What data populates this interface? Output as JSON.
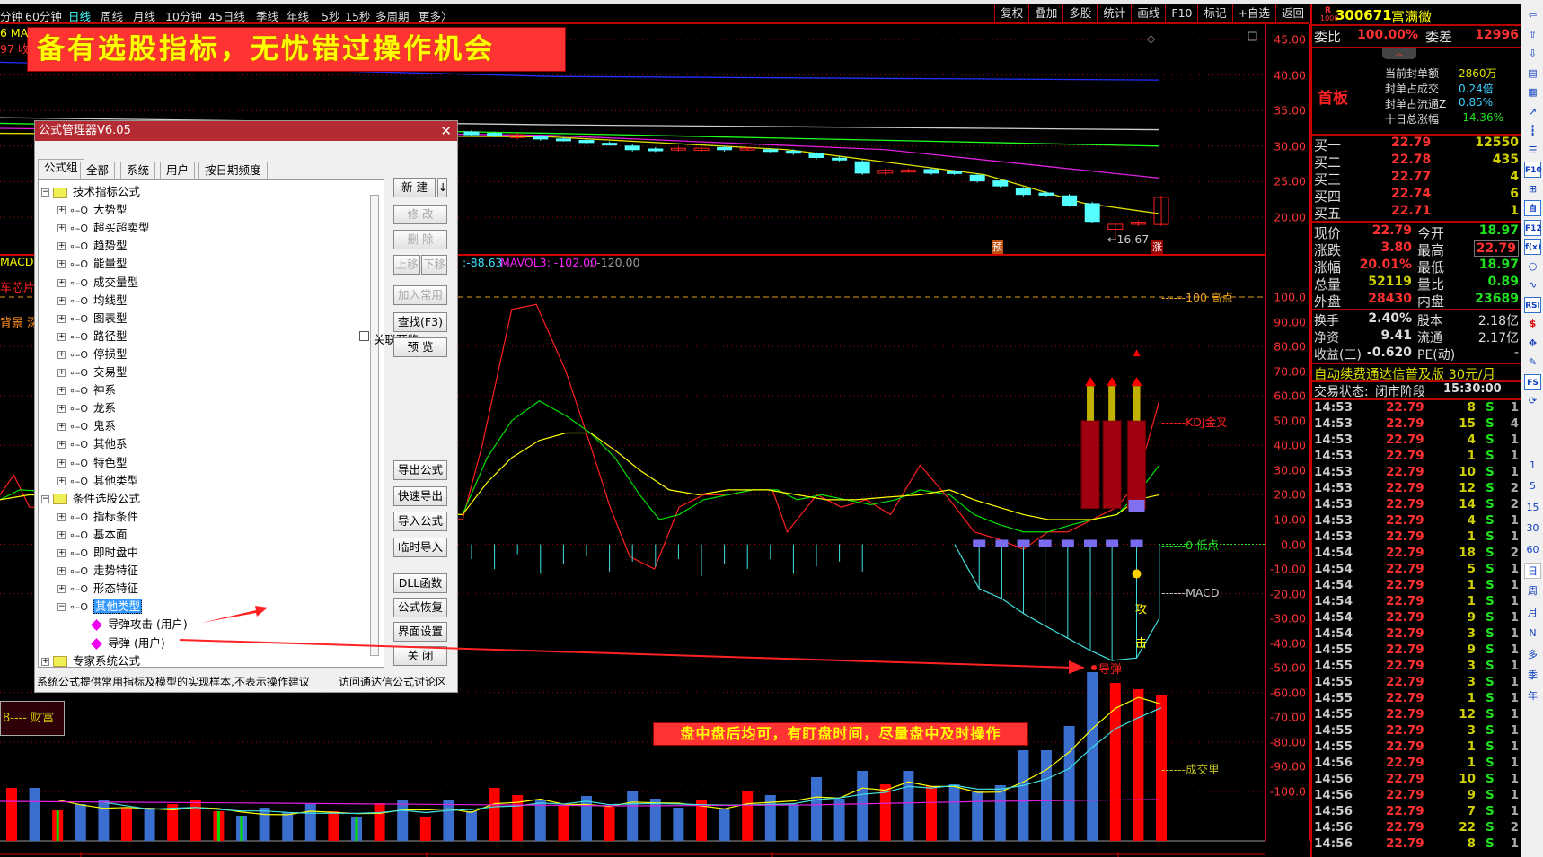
{
  "toolbar": {
    "periods": [
      {
        "label": "分钟",
        "selected": false
      },
      {
        "label": "60分钟",
        "selected": false
      },
      {
        "label": "日线",
        "selected": true
      },
      {
        "label": "周线",
        "selected": false
      },
      {
        "label": "月线",
        "selected": false
      },
      {
        "label": "10分钟",
        "selected": false
      },
      {
        "label": "45日线",
        "selected": false
      },
      {
        "label": "季线",
        "selected": false
      },
      {
        "label": "年线",
        "selected": false
      },
      {
        "label": "5秒",
        "selected": false
      },
      {
        "label": "15秒",
        "selected": false
      },
      {
        "label": "多周期",
        "selected": false
      },
      {
        "label": "更多〉",
        "selected": false
      }
    ],
    "buttons": [
      "复权",
      "叠加",
      "多股",
      "统计",
      "画线",
      "F10",
      "标记",
      "+自选",
      "返回"
    ]
  },
  "banner_top": "备有选股指标，无忧错过操作机会",
  "banner_bottom": "盘中盘后均可，有盯盘时间，尽量盘中及时操作",
  "chart": {
    "left_labels": {
      "ma_fragment": "6  MA",
      "close_fragment": "97 收",
      "macd_fragment": "MACD:",
      "concept1": "车芯片",
      "concept2": "背景 深股",
      "caifu": "8---- 财富"
    },
    "indicator_values": {
      "v1": ":-88.63",
      "mavol3": "MAVOL3: -102.00",
      "v3": ": -120.00"
    },
    "price_axis": [
      "45.00",
      "40.00",
      "35.00",
      "30.00",
      "25.00",
      "20.00"
    ],
    "ind_axis": [
      "100.0",
      "90.00",
      "80.00",
      "70.00",
      "60.00",
      "50.00",
      "40.00",
      "30.00",
      "20.00",
      "10.00",
      "0.00",
      "-10.00",
      "-20.00",
      "-30.00",
      "-40.00",
      "-50.00",
      "-60.00",
      "-70.00",
      "-80.00",
      "-90.00",
      "-100.0"
    ],
    "low_price_label": "←16.67",
    "badge_yu": "预",
    "badge_zhang": "涨",
    "line_labels": {
      "high": "------100 高点",
      "kdj": "------KDJ金叉",
      "low": "------0  低点",
      "macd": "------MACD",
      "volume": "------成交里"
    },
    "signal_attack1": "攻",
    "signal_attack2": "击",
    "missile": "导弹",
    "colors": {
      "up": "#ff2020",
      "down": "#54ffff",
      "k": "#ff2020",
      "d": "#00e000",
      "j": "#ffff00",
      "vol_blue": "#3a6fd0"
    }
  },
  "dialog": {
    "title": "公式管理器V6.05",
    "tabs": [
      "公式组",
      "全部",
      "系统",
      "用户",
      "按日期频度"
    ],
    "tree": [
      {
        "label": "技术指标公式",
        "level": 0,
        "type": "folder",
        "expanded": true
      },
      {
        "label": "大势型",
        "level": 1
      },
      {
        "label": "超买超卖型",
        "level": 1
      },
      {
        "label": "趋势型",
        "level": 1
      },
      {
        "label": "能量型",
        "level": 1
      },
      {
        "label": "成交量型",
        "level": 1
      },
      {
        "label": "均线型",
        "level": 1
      },
      {
        "label": "图表型",
        "level": 1
      },
      {
        "label": "路径型",
        "level": 1
      },
      {
        "label": "停损型",
        "level": 1
      },
      {
        "label": "交易型",
        "level": 1
      },
      {
        "label": "神系",
        "level": 1
      },
      {
        "label": "龙系",
        "level": 1
      },
      {
        "label": "鬼系",
        "level": 1
      },
      {
        "label": "其他系",
        "level": 1
      },
      {
        "label": "特色型",
        "level": 1
      },
      {
        "label": "其他类型",
        "level": 1
      },
      {
        "label": "条件选股公式",
        "level": 0,
        "type": "folder",
        "expanded": true
      },
      {
        "label": "指标条件",
        "level": 1
      },
      {
        "label": "基本面",
        "level": 1
      },
      {
        "label": "即时盘中",
        "level": 1
      },
      {
        "label": "走势特征",
        "level": 1
      },
      {
        "label": "形态特征",
        "level": 1
      },
      {
        "label": "其他类型",
        "level": 1,
        "expanded": true,
        "selected": true
      },
      {
        "label": "导弹攻击  (用户)",
        "level": 2,
        "type": "formula"
      },
      {
        "label": "导弹  (用户)",
        "level": 2,
        "type": "formula"
      },
      {
        "label": "专家系统公式",
        "level": 0,
        "type": "folder",
        "expanded": false
      }
    ],
    "buttons": {
      "new": "新  建",
      "new_arrow": "↓",
      "modify": "修  改",
      "delete": "删  除",
      "up": "上移",
      "down": "下移",
      "add_common": "加入常用",
      "find": "查找(F3)",
      "preview": "预  览",
      "link_preview": "关联预览",
      "export": "导出公式",
      "quick_export": "快速导出",
      "import": "导入公式",
      "temp_import": "临时导入",
      "dll": "DLL函数",
      "restore": "公式恢复",
      "ui_settings": "界面设置",
      "close": "关  闭"
    },
    "status_left": "系统公式提供常用指标及模型的实现样本,不表示操作建议",
    "status_right": "访问通达信公式讨论区"
  },
  "quote": {
    "badge_top": "R",
    "badge_bottom": "1000",
    "code": "300671",
    "name": "富满微",
    "weibi_label": "委比",
    "weibi": "100.00%",
    "weicha_label": "委差",
    "weicha": "12996",
    "board": "首板",
    "seal": [
      {
        "label": "当前封单额",
        "value": "2860万",
        "color": "#e0e000"
      },
      {
        "label": "封单占成交",
        "value": "0.24倍",
        "color": "#40d0ff"
      },
      {
        "label": "封单占流通Z",
        "value": "0.85%",
        "color": "#40d0ff"
      },
      {
        "label": "十日总涨幅",
        "value": "-14.36%",
        "color": "#20e020"
      }
    ],
    "bids": [
      {
        "label": "买一",
        "price": "22.79",
        "vol": "12550"
      },
      {
        "label": "买二",
        "price": "22.78",
        "vol": "435"
      },
      {
        "label": "买三",
        "price": "22.77",
        "vol": "4"
      },
      {
        "label": "买四",
        "price": "22.74",
        "vol": "6"
      },
      {
        "label": "买五",
        "price": "22.71",
        "vol": "1"
      }
    ],
    "stats": [
      {
        "l1": "现价",
        "v1": "22.79",
        "c1": "#ff3030",
        "l2": "今开",
        "v2": "18.97",
        "c2": "#20e020"
      },
      {
        "l1": "涨跌",
        "v1": "3.80",
        "c1": "#ff3030",
        "l2": "最高",
        "v2": "22.79",
        "c2": "#ff3030"
      },
      {
        "l1": "涨幅",
        "v1": "20.01%",
        "c1": "#ff3030",
        "l2": "最低",
        "v2": "18.97",
        "c2": "#20e020"
      },
      {
        "l1": "总量",
        "v1": "52119",
        "c1": "#d0d000",
        "l2": "量比",
        "v2": "0.89",
        "c2": "#20e020"
      },
      {
        "l1": "外盘",
        "v1": "28430",
        "c1": "#ff3030",
        "l2": "内盘",
        "v2": "23689",
        "c2": "#20e020"
      }
    ],
    "fund": [
      {
        "l1": "换手",
        "v1": "2.40%",
        "l2": "股本",
        "v2": "2.18亿"
      },
      {
        "l1": "净资",
        "v1": "9.41",
        "l2": "流通",
        "v2": "2.17亿"
      },
      {
        "l1": "收益(三)",
        "v1": "-0.620",
        "l2": "PE(动)",
        "v2": "-"
      }
    ],
    "promo": "自动续费通达信普及版  30元/月",
    "status_label": "交易状态:",
    "status_value": "闭市阶段",
    "status_time": "15:30:00",
    "trades": [
      [
        "14:53",
        "22.79",
        "8",
        "S",
        "1"
      ],
      [
        "14:53",
        "22.79",
        "15",
        "S",
        "4"
      ],
      [
        "14:53",
        "22.79",
        "4",
        "S",
        "1"
      ],
      [
        "14:53",
        "22.79",
        "1",
        "S",
        "1"
      ],
      [
        "14:53",
        "22.79",
        "10",
        "S",
        "1"
      ],
      [
        "14:53",
        "22.79",
        "12",
        "S",
        "2"
      ],
      [
        "14:53",
        "22.79",
        "14",
        "S",
        "2"
      ],
      [
        "14:53",
        "22.79",
        "4",
        "S",
        "1"
      ],
      [
        "14:53",
        "22.79",
        "1",
        "S",
        "1"
      ],
      [
        "14:54",
        "22.79",
        "18",
        "S",
        "2"
      ],
      [
        "14:54",
        "22.79",
        "5",
        "S",
        "1"
      ],
      [
        "14:54",
        "22.79",
        "1",
        "S",
        "1"
      ],
      [
        "14:54",
        "22.79",
        "1",
        "S",
        "1"
      ],
      [
        "14:54",
        "22.79",
        "9",
        "S",
        "1"
      ],
      [
        "14:54",
        "22.79",
        "3",
        "S",
        "1"
      ],
      [
        "14:55",
        "22.79",
        "9",
        "S",
        "1"
      ],
      [
        "14:55",
        "22.79",
        "3",
        "S",
        "1"
      ],
      [
        "14:55",
        "22.79",
        "3",
        "S",
        "1"
      ],
      [
        "14:55",
        "22.79",
        "1",
        "S",
        "1"
      ],
      [
        "14:55",
        "22.79",
        "12",
        "S",
        "1"
      ],
      [
        "14:55",
        "22.79",
        "3",
        "S",
        "1"
      ],
      [
        "14:55",
        "22.79",
        "1",
        "S",
        "1"
      ],
      [
        "14:56",
        "22.79",
        "1",
        "S",
        "1"
      ],
      [
        "14:56",
        "22.79",
        "10",
        "S",
        "1"
      ],
      [
        "14:56",
        "22.79",
        "9",
        "S",
        "1"
      ],
      [
        "14:56",
        "22.79",
        "7",
        "S",
        "1"
      ],
      [
        "14:56",
        "22.79",
        "22",
        "S",
        "2"
      ],
      [
        "14:56",
        "22.79",
        "8",
        "S",
        "1"
      ]
    ]
  },
  "iconbar": {
    "icons": [
      "arrow-left-icon",
      "arrow-up-icon",
      "arrow-down-icon",
      "report-icon",
      "table-icon",
      "line-chart-icon",
      "candle-icon",
      "list-icon",
      "f10-icon",
      "tree-icon",
      "self-icon",
      "f12-icon",
      "fx-icon",
      "circle-icon",
      "wave-icon",
      "rsi-icon",
      "money-icon",
      "move-icon",
      "pencil-icon",
      "fs-icon",
      "refresh-icon"
    ],
    "icon_text": {
      "f10-icon": "F10",
      "self-icon": "自",
      "f12-icon": "F12",
      "fx-icon": "f(x)",
      "rsi-icon": "RSI",
      "fs-icon": "FS"
    },
    "periods": [
      "1",
      "5",
      "15",
      "30",
      "60",
      "日",
      "周",
      "月",
      "N",
      "多",
      "季",
      "年"
    ],
    "selected_period": "日"
  }
}
